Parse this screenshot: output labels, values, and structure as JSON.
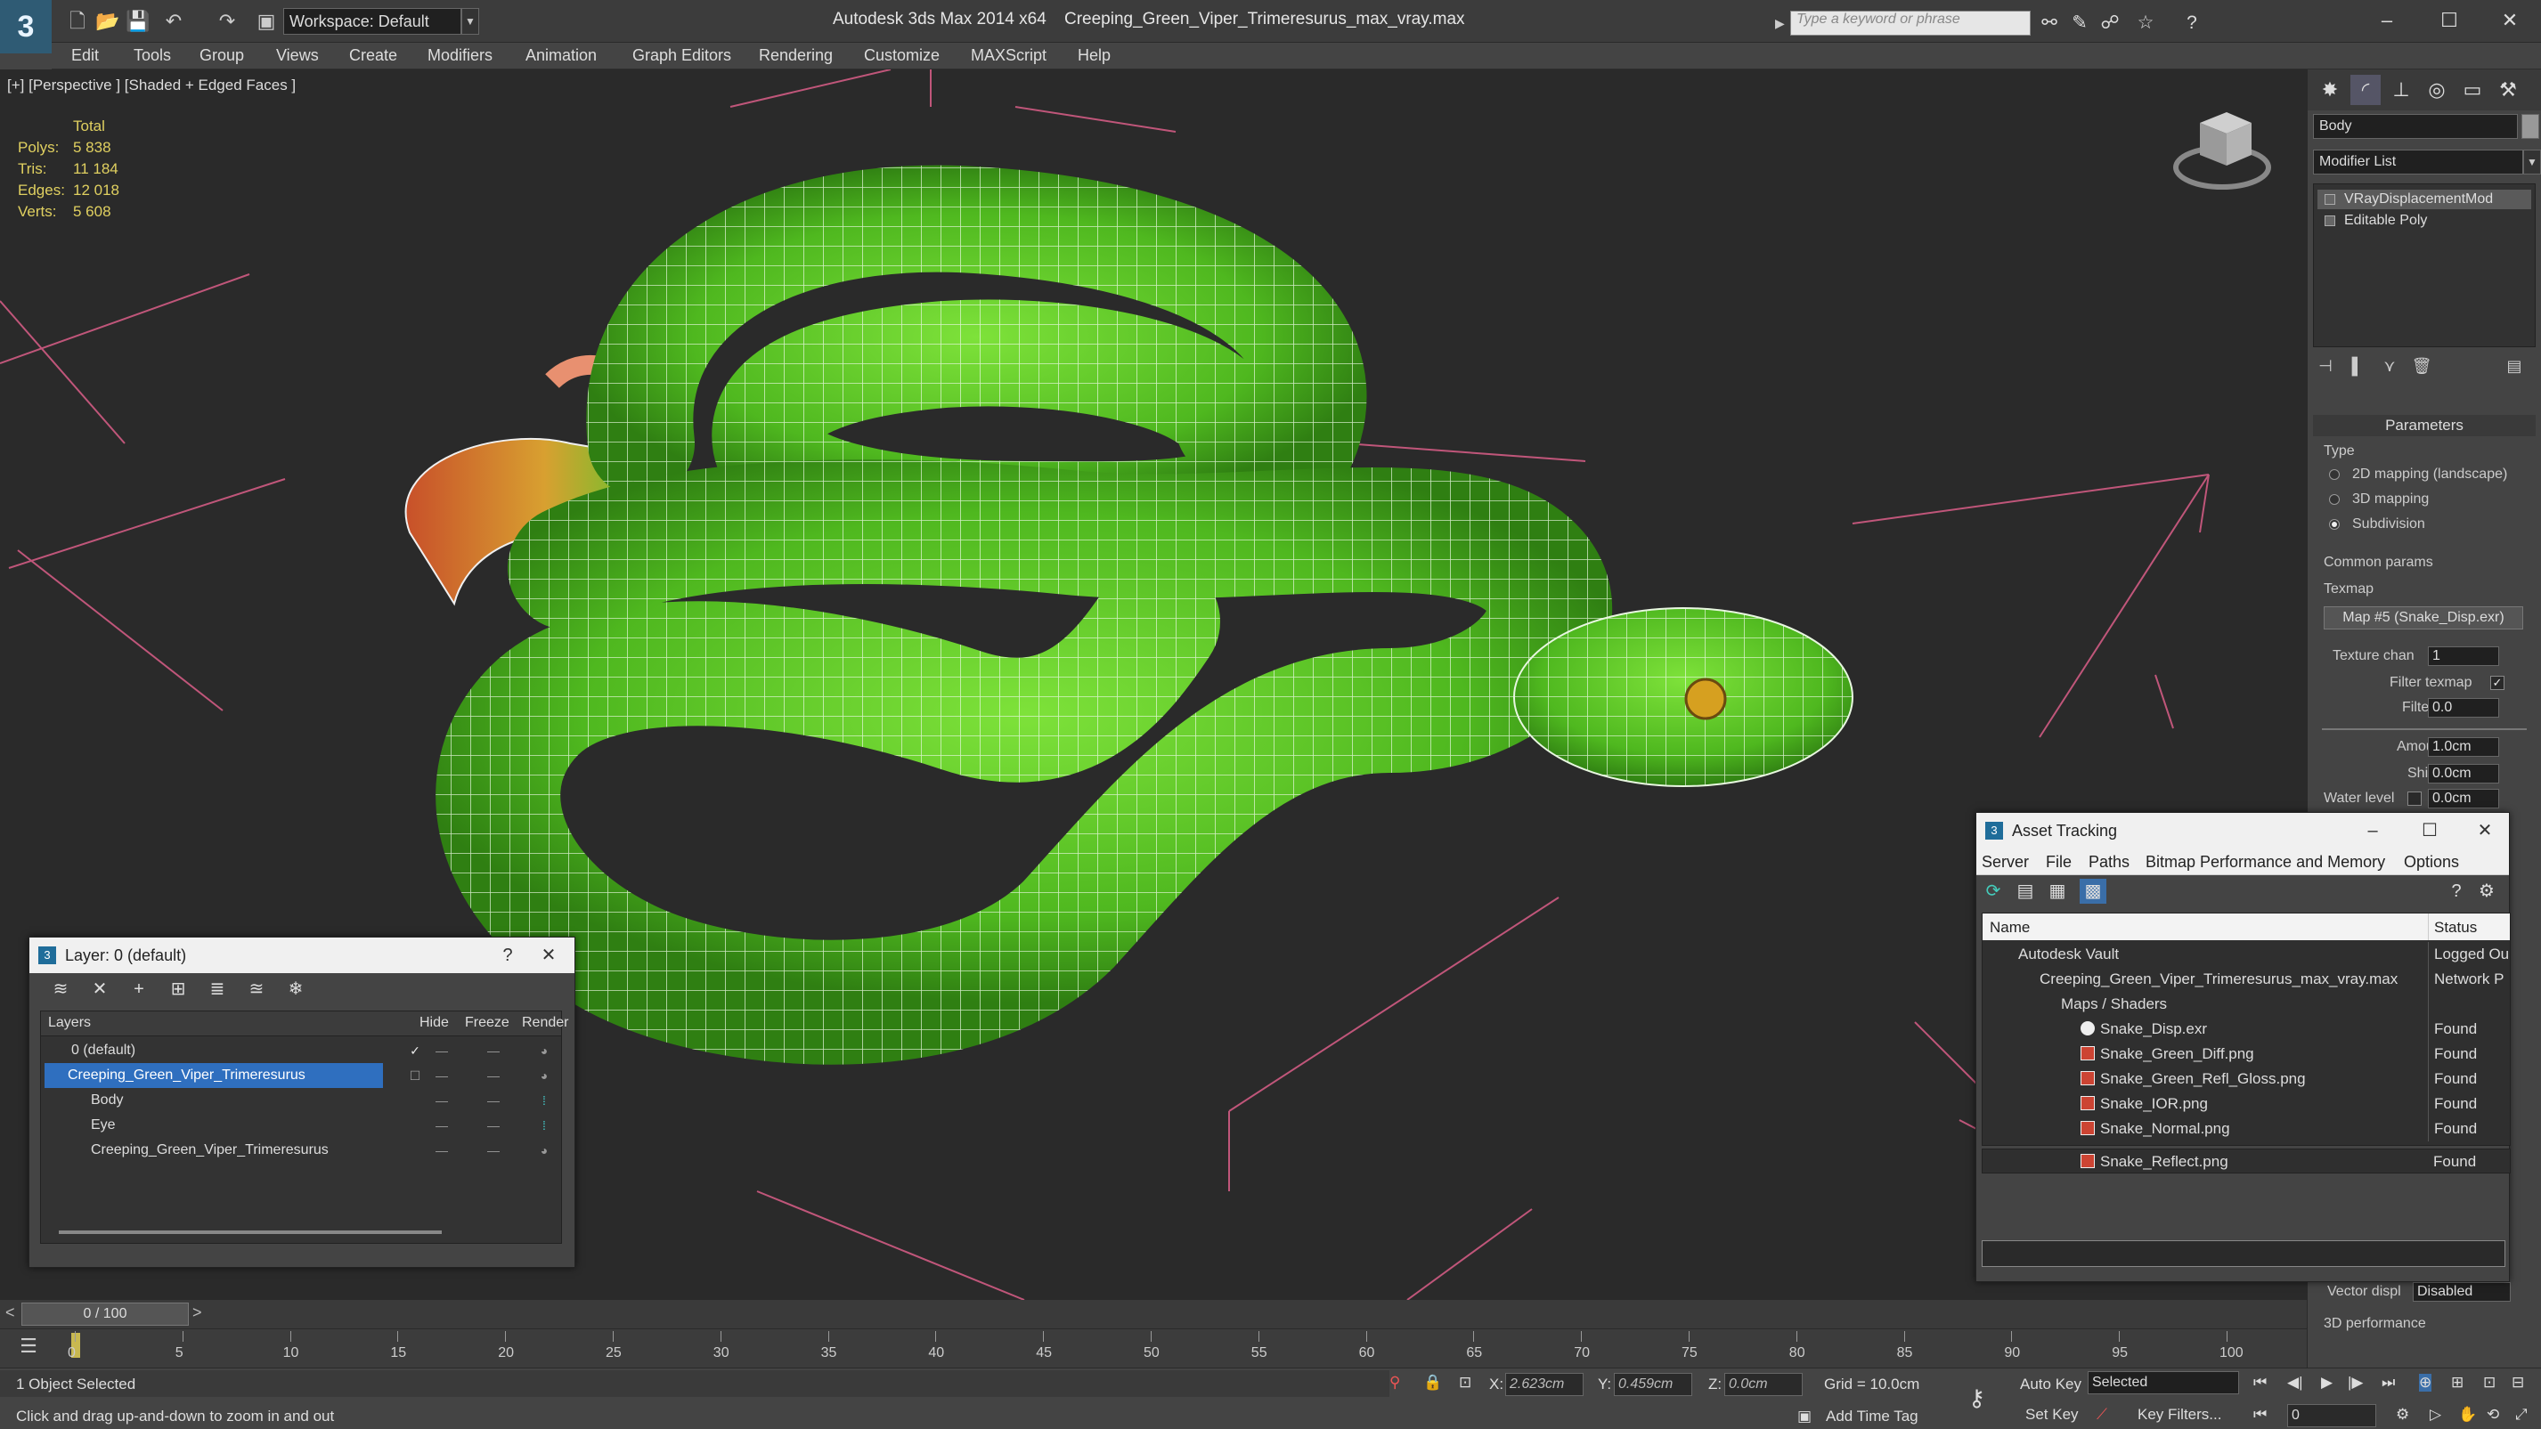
{
  "window": {
    "app_title": "Autodesk 3ds Max  2014 x64",
    "file_title": "Creeping_Green_Viper_Trimeresurus_max_vray.max",
    "logo": "3",
    "workspace": "Workspace: Default",
    "search_placeholder": "Type a keyword or phrase",
    "minimize": "–",
    "maximize": "☐",
    "close": "✕"
  },
  "menu": [
    "Edit",
    "Tools",
    "Group",
    "Views",
    "Create",
    "Modifiers",
    "Animation",
    "Graph Editors",
    "Rendering",
    "Customize",
    "MAXScript",
    "Help"
  ],
  "viewport": {
    "label": "[+] [Perspective ] [Shaded + Edged Faces ]",
    "stats": {
      "header": "Total",
      "rows": [
        {
          "k": "Polys:",
          "v": "5 838"
        },
        {
          "k": "Tris:",
          "v": "11 184"
        },
        {
          "k": "Edges:",
          "v": "12 018"
        },
        {
          "k": "Verts:",
          "v": "5 608"
        }
      ]
    }
  },
  "command_panel": {
    "object_name": "Body",
    "modifier_list": "Modifier List",
    "stack": [
      "VRayDisplacementMod",
      "Editable Poly"
    ],
    "parameters_title": "Parameters",
    "type_label": "Type",
    "type_options": [
      "2D mapping (landscape)",
      "3D mapping",
      "Subdivision"
    ],
    "type_selected": 2,
    "common_params": "Common params",
    "texmap_label": "Texmap",
    "texmap_button": "Map #5 (Snake_Disp.exr)",
    "texture_chan_label": "Texture chan",
    "texture_chan": "1",
    "filter_texmap_label": "Filter texmap",
    "filter_blur_label": "Filter blur",
    "filter_blur": "0.0",
    "amount_label": "Amount",
    "amount": "1.0cm",
    "shift_label": "Shift",
    "shift": "0.0cm",
    "water_level_label": "Water level",
    "water_level": "0.0cm",
    "vector_disp_label": "Vector displ",
    "vector_disp": "Disabled",
    "perf_label": "3D performance"
  },
  "layer_dialog": {
    "title": "Layer: 0 (default)",
    "help": "?",
    "close": "✕",
    "columns": [
      "Layers",
      "Hide",
      "Freeze",
      "Render"
    ],
    "rows": [
      {
        "name": "0 (default)",
        "indent": 0,
        "selected": false
      },
      {
        "name": "Creeping_Green_Viper_Trimeresurus",
        "indent": 0,
        "selected": true
      },
      {
        "name": "Body",
        "indent": 1,
        "selected": false
      },
      {
        "name": "Eye",
        "indent": 1,
        "selected": false
      },
      {
        "name": "Creeping_Green_Viper_Trimeresurus",
        "indent": 1,
        "selected": false
      }
    ]
  },
  "asset_dialog": {
    "title": "Asset Tracking",
    "minimize": "–",
    "maximize": "☐",
    "close": "✕",
    "menu": [
      "Server",
      "File",
      "Paths",
      "Bitmap Performance and Memory",
      "Options"
    ],
    "columns": [
      "Name",
      "Status"
    ],
    "rows": [
      {
        "name": "Autodesk Vault",
        "status": "Logged Ou",
        "indent": 1
      },
      {
        "name": "Creeping_Green_Viper_Trimeresurus_max_vray.max",
        "status": "Network P",
        "indent": 2
      },
      {
        "name": "Maps / Shaders",
        "status": "",
        "indent": 3
      },
      {
        "name": "Snake_Disp.exr",
        "status": "Found",
        "indent": 4
      },
      {
        "name": "Snake_Green_Diff.png",
        "status": "Found",
        "indent": 4
      },
      {
        "name": "Snake_Green_Refl_Gloss.png",
        "status": "Found",
        "indent": 4
      },
      {
        "name": "Snake_IOR.png",
        "status": "Found",
        "indent": 4
      },
      {
        "name": "Snake_Normal.png",
        "status": "Found",
        "indent": 4
      },
      {
        "name": "Snake_Reflect.png",
        "status": "Found",
        "indent": 4
      }
    ]
  },
  "timeline": {
    "frame": "0 / 100",
    "ticks": [
      "0",
      "5",
      "10",
      "15",
      "20",
      "25",
      "30",
      "35",
      "40",
      "45",
      "50",
      "55",
      "60",
      "65",
      "70",
      "75",
      "80",
      "85",
      "90",
      "95",
      "100"
    ]
  },
  "status": {
    "selected": "1 Object Selected",
    "prompt": "Click and drag up-and-down to zoom in and out",
    "x_label": "X:",
    "x": "2.623cm",
    "y_label": "Y:",
    "y": "0.459cm",
    "z_label": "Z:",
    "z": "0.0cm",
    "grid": "Grid = 10.0cm",
    "auto_key": "Auto Key",
    "key_mode": "Selected",
    "set_key": "Set Key",
    "key_filters": "Key Filters...",
    "add_time_tag": "Add Time Tag",
    "frame_field": "0"
  }
}
